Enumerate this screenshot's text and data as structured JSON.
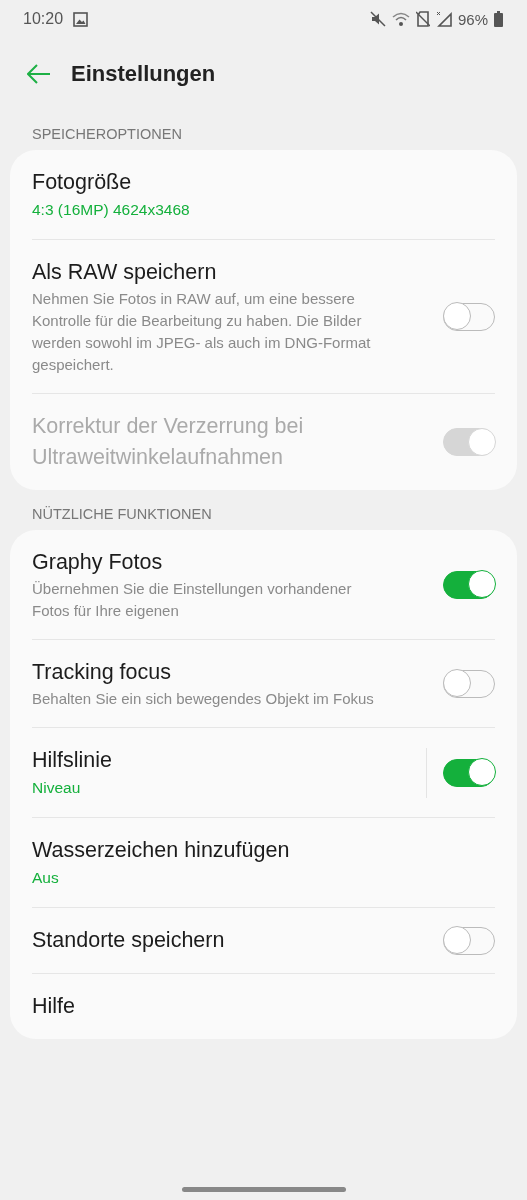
{
  "status_bar": {
    "time": "10:20",
    "battery": "96%"
  },
  "header": {
    "title": "Einstellungen"
  },
  "sections": [
    {
      "label": "SPEICHEROPTIONEN",
      "rows": [
        {
          "title": "Fotogröße",
          "value": "4:3 (16MP) 4624x3468",
          "disabled": false
        },
        {
          "title": "Als RAW speichern",
          "description": "Nehmen Sie Fotos in RAW auf, um eine bessere Kontrolle für die Bearbeitung zu haben. Die Bilder werden sowohl im JPEG- als auch im DNG-Format gespeichert.",
          "disabled": false,
          "on": false
        },
        {
          "title": "Korrektur der Verzerrung bei Ultraweitwinkelaufnahmen",
          "disabled": true,
          "on": true
        }
      ]
    },
    {
      "label": "NÜTZLICHE FUNKTIONEN",
      "rows": [
        {
          "title": "Graphy Fotos",
          "description": "Übernehmen Sie die Einstellungen vorhandener Fotos für Ihre eigenen",
          "disabled": false,
          "on": true
        },
        {
          "title": "Tracking focus",
          "description": "Behalten Sie ein sich bewegendes Objekt im Fokus",
          "disabled": false,
          "on": false
        },
        {
          "title": "Hilfslinie",
          "value": "Niveau",
          "disabled": false,
          "on": true
        },
        {
          "title": "Wasserzeichen hinzufügen",
          "value": "Aus",
          "disabled": false
        },
        {
          "title": "Standorte speichern",
          "disabled": false,
          "on": false
        },
        {
          "title": "Hilfe",
          "disabled": false
        }
      ]
    }
  ]
}
